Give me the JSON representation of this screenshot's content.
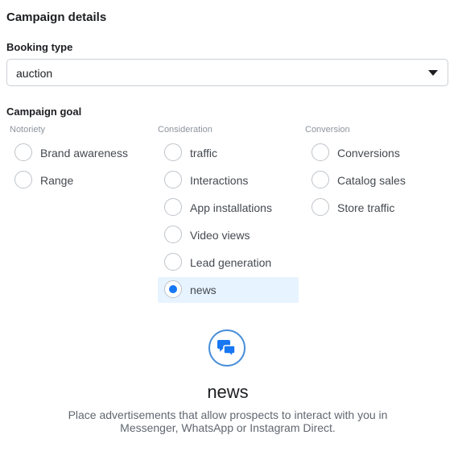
{
  "section_title": "Campaign details",
  "booking": {
    "label": "Booking type",
    "value": "auction"
  },
  "goal": {
    "label": "Campaign goal",
    "columns": [
      {
        "header": "Notoriety",
        "options": [
          "Brand awareness",
          "Range"
        ]
      },
      {
        "header": "Consideration",
        "options": [
          "traffic",
          "Interactions",
          "App installations",
          "Video views",
          "Lead generation",
          "news"
        ]
      },
      {
        "header": "Conversion",
        "options": [
          "Conversions",
          "Catalog sales",
          "Store traffic"
        ]
      }
    ],
    "selected": "news"
  },
  "preview": {
    "icon": "messages-icon",
    "title": "news",
    "description": "Place advertisements that allow prospects to interact with you in Messenger, WhatsApp or Instagram Direct."
  },
  "colors": {
    "accent": "#1877f2",
    "selected_bg": "#e7f3ff",
    "icon_ring": "#4a90d9"
  }
}
